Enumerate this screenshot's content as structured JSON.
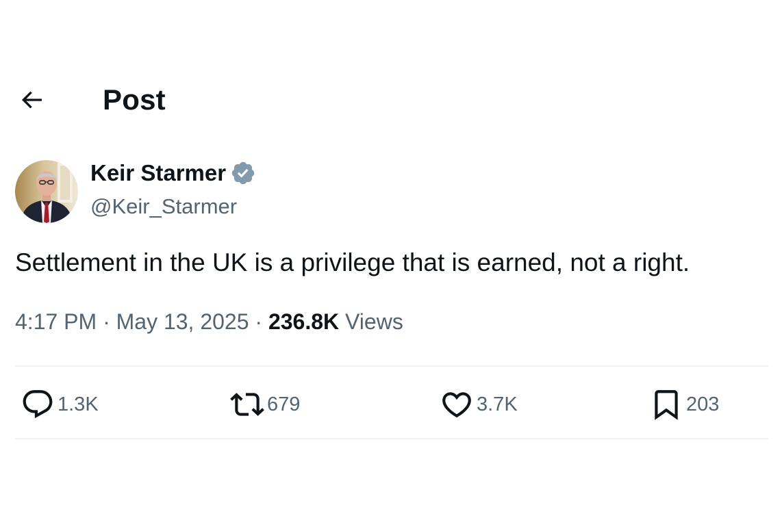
{
  "header": {
    "title": "Post",
    "back_icon": "arrow-left-icon"
  },
  "tweet": {
    "author": {
      "display_name": "Keir Starmer",
      "handle": "@Keir_Starmer",
      "verified_icon": "verified-badge-icon",
      "verified_color": "#829aab"
    },
    "text": "Settlement in the UK is a privilege that is earned, not a right.",
    "time": "4:17 PM",
    "separator": "·",
    "date": "May 13, 2025",
    "views_count": "236.8K",
    "views_label": "Views"
  },
  "actions": {
    "replies": {
      "icon": "reply-icon",
      "count": "1.3K"
    },
    "reposts": {
      "icon": "repost-icon",
      "count": "679"
    },
    "likes": {
      "icon": "heart-icon",
      "count": "3.7K"
    },
    "bookmarks": {
      "icon": "bookmark-icon",
      "count": "203"
    }
  },
  "colors": {
    "text_primary": "#0f1419",
    "text_secondary": "#536471",
    "divider": "#eff3f4"
  }
}
